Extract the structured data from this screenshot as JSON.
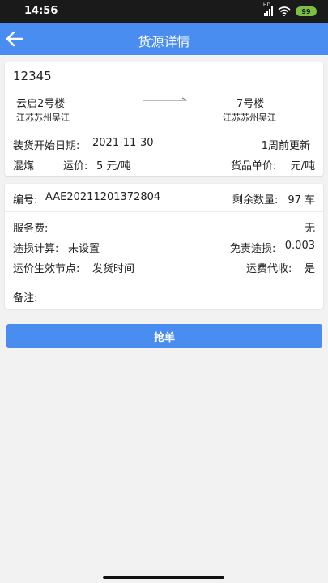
{
  "status": {
    "time": "14:56",
    "signal": "HD",
    "battery": "99"
  },
  "header": {
    "title": "货源详情"
  },
  "cargo": {
    "id": "12345",
    "origin": {
      "name": "云启2号楼",
      "region": "江苏苏州吴江"
    },
    "destination": {
      "name": "7号楼",
      "region": "江苏苏州吴江"
    },
    "load_date_label": "装货开始日期:",
    "load_date": "2021-11-30",
    "updated": "1周前更新",
    "cargo_type": "混煤",
    "freight_label": "运价:",
    "freight_value": "5 元/吨",
    "unit_price_label": "货品单价:",
    "unit_price_value": "元/吨"
  },
  "details": {
    "number_label": "编号:",
    "number": "AAE20211201372804",
    "remaining_label": "剩余数量:",
    "remaining": "97 车",
    "service_fee_label": "服务费:",
    "service_fee": "无",
    "loss_calc_label": "途损计算:",
    "loss_calc": "未设置",
    "free_loss_label": "免责途损:",
    "free_loss": "0.003",
    "effective_node_label": "运价生效节点:",
    "effective_node": "发货时间",
    "collect_label": "运费代收:",
    "collect": "是",
    "remarks_label": "备注:"
  },
  "actions": {
    "grab_label": "抢单"
  },
  "colors": {
    "primary": "#4a8df1",
    "background": "#f2f2f2"
  }
}
